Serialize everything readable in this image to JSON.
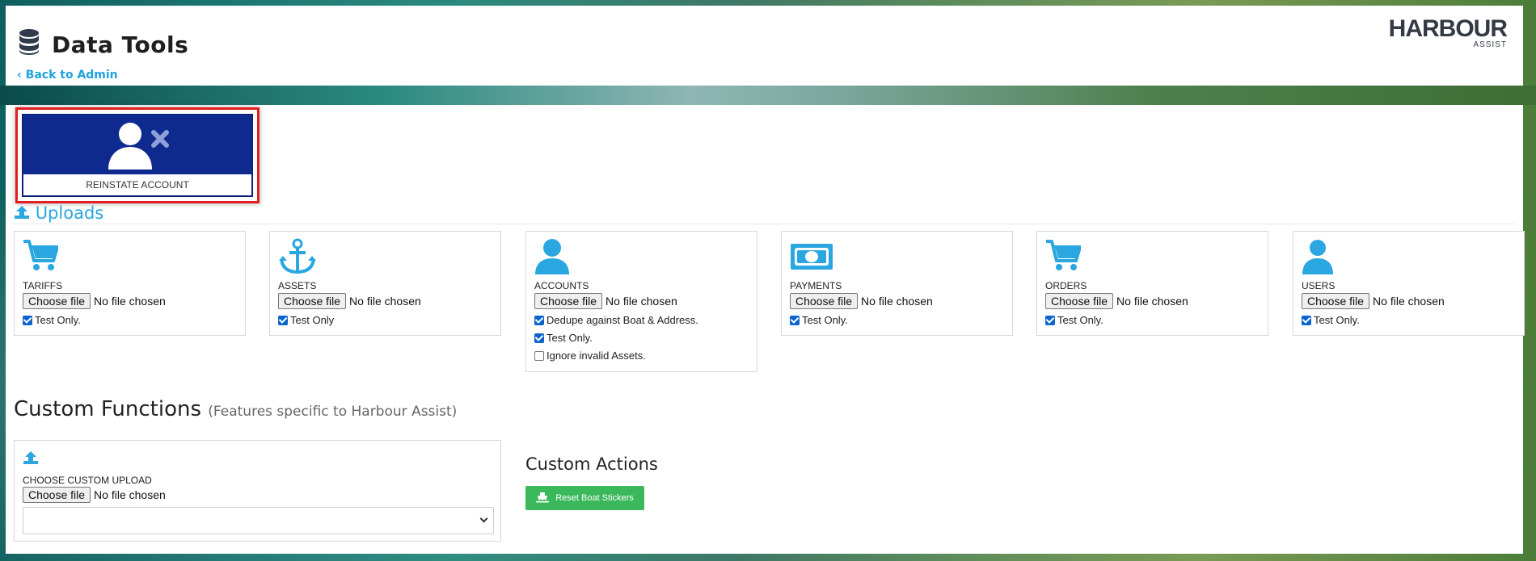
{
  "header": {
    "title": "Data Tools",
    "back_link": "Back to Admin",
    "logo_main": "HARBOUR",
    "logo_sub": "ASSIST"
  },
  "reinstate": {
    "label": "REINSTATE ACCOUNT"
  },
  "uploads": {
    "section_title": "Uploads",
    "cards": [
      {
        "label": "TARIFFS",
        "icon": "cart-icon",
        "choose": "Choose file",
        "status": "No file chosen",
        "options": [
          {
            "label": "Test Only.",
            "checked": true
          }
        ]
      },
      {
        "label": "ASSETS",
        "icon": "anchor-icon",
        "choose": "Choose file",
        "status": "No file chosen",
        "options": [
          {
            "label": "Test Only",
            "checked": true
          }
        ]
      },
      {
        "label": "ACCOUNTS",
        "icon": "user-icon",
        "choose": "Choose file",
        "status": "No file chosen",
        "options": [
          {
            "label": "Dedupe against Boat & Address.",
            "checked": true
          },
          {
            "label": "Test Only.",
            "checked": true
          },
          {
            "label": "Ignore invalid Assets.",
            "checked": false
          }
        ]
      },
      {
        "label": "PAYMENTS",
        "icon": "money-icon",
        "choose": "Choose file",
        "status": "No file chosen",
        "options": [
          {
            "label": "Test Only.",
            "checked": true
          }
        ]
      },
      {
        "label": "ORDERS",
        "icon": "cart-icon",
        "choose": "Choose file",
        "status": "No file chosen",
        "options": [
          {
            "label": "Test Only.",
            "checked": true
          }
        ]
      },
      {
        "label": "USERS",
        "icon": "user-icon",
        "choose": "Choose file",
        "status": "No file chosen",
        "options": [
          {
            "label": "Test Only.",
            "checked": true
          }
        ]
      }
    ]
  },
  "custom_functions": {
    "title": "Custom Functions",
    "subtitle": "(Features specific to Harbour Assist)",
    "upload_label": "CHOOSE CUSTOM UPLOAD",
    "choose": "Choose file",
    "status": "No file chosen",
    "select_value": ""
  },
  "custom_actions": {
    "title": "Custom Actions",
    "reset_button": "Reset Boat Stickers"
  },
  "colors": {
    "accent": "#2aa7e1",
    "reinstate_bg": "#0f2a8f",
    "highlight": "#e02020",
    "success": "#3bb85c"
  }
}
